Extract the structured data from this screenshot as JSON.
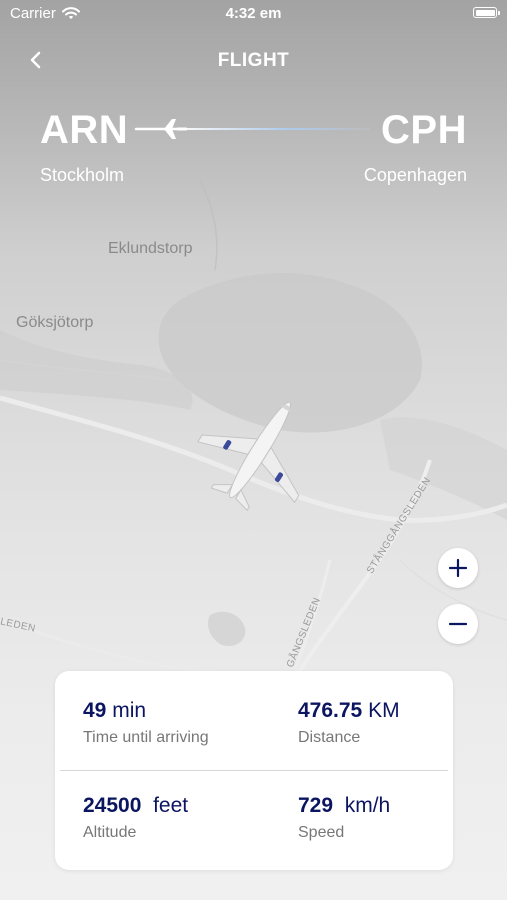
{
  "status_bar": {
    "carrier": "Carrier",
    "time": "4:32 em"
  },
  "header": {
    "title": "FLIGHT"
  },
  "route": {
    "origin_code": "ARN",
    "origin_city": "Stockholm",
    "destination_code": "CPH",
    "destination_city": "Copenhagen"
  },
  "map": {
    "labels": [
      "Eklundstorp",
      "Göksjötorp"
    ],
    "road_labels": [
      "STÅNGGÅNGSLEDEN",
      "LEDEN",
      "GÅNGSLEDEN"
    ]
  },
  "zoom": {
    "in": "+",
    "out": "−"
  },
  "stats": {
    "time": {
      "value": "49",
      "unit": "min",
      "label": "Time until arriving"
    },
    "distance": {
      "value": "476.75",
      "unit": "KM",
      "label": "Distance"
    },
    "altitude": {
      "value": "24500",
      "unit": "feet",
      "label": "Altitude"
    },
    "speed": {
      "value": "729",
      "unit": "km/h",
      "label": "Speed"
    }
  },
  "colors": {
    "accent": "#0b1560",
    "text_muted": "#777777",
    "card": "#ffffff"
  }
}
